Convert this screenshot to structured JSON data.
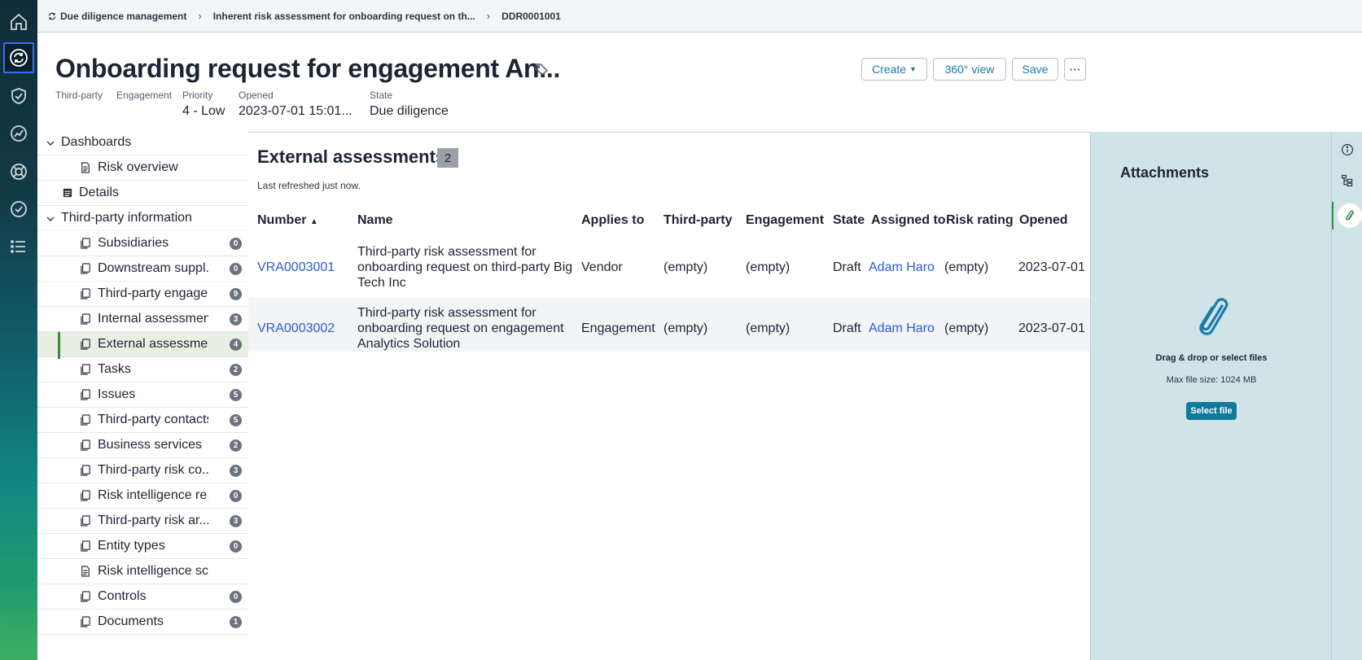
{
  "breadcrumb": {
    "items": [
      "Due diligence management",
      "Inherent risk assessment for onboarding request on th...",
      "DDR0001001"
    ]
  },
  "rail": {
    "icons": [
      "home-icon",
      "sync-icon",
      "shield-check-icon",
      "analytics-icon",
      "support-icon",
      "check-circle-icon",
      "list-icon"
    ]
  },
  "header": {
    "title": "Onboarding request for engagement An...",
    "meta": [
      {
        "label": "Third-party",
        "value": ""
      },
      {
        "label": "Engagement",
        "value": ""
      },
      {
        "label": "Priority",
        "value": "4 - Low"
      },
      {
        "label": "Opened",
        "value": "2023-07-01 15:01..."
      },
      {
        "label": "State",
        "value": "Due diligence"
      }
    ],
    "buttons": {
      "create": "Create",
      "view360": "360° view",
      "save": "Save",
      "more": "···"
    }
  },
  "nav": {
    "items": [
      {
        "label": "Dashboards",
        "count": null
      },
      {
        "label": "Risk overview",
        "count": null
      },
      {
        "label": "Details",
        "count": null
      },
      {
        "label": "Third-party information",
        "count": null
      },
      {
        "label": "Subsidiaries",
        "count": "0"
      },
      {
        "label": "Downstream suppl...",
        "count": "0"
      },
      {
        "label": "Third-party engage...",
        "count": "9"
      },
      {
        "label": "Internal assessments",
        "count": "3"
      },
      {
        "label": "External assessme...",
        "count": "4"
      },
      {
        "label": "Tasks",
        "count": "2"
      },
      {
        "label": "Issues",
        "count": "5"
      },
      {
        "label": "Third-party contacts",
        "count": "5"
      },
      {
        "label": "Business services",
        "count": "2"
      },
      {
        "label": "Third-party risk co...",
        "count": "3"
      },
      {
        "label": "Risk intelligence re...",
        "count": "0"
      },
      {
        "label": "Third-party risk ar...",
        "count": "3"
      },
      {
        "label": "Entity types",
        "count": "0"
      },
      {
        "label": "Risk intelligence scores",
        "count": null
      },
      {
        "label": "Controls",
        "count": "0"
      },
      {
        "label": "Documents",
        "count": "1"
      }
    ]
  },
  "main": {
    "title": "External assessments",
    "count": "2",
    "refreshed": "Last refreshed just now.",
    "sort_indicator": "▲",
    "columns": [
      "Number",
      "Name",
      "Applies to",
      "Third-party",
      "Engagement",
      "State",
      "Assigned to",
      "Risk rating",
      "Opened"
    ],
    "rows": [
      {
        "number": "VRA0003001",
        "name": "Third-party risk assessment for onboarding request on third-party Big Tech Inc",
        "applies_to": "Vendor",
        "third_party": "(empty)",
        "engagement": "(empty)",
        "state": "Draft",
        "assigned_to": "Adam Haro",
        "risk_rating": "(empty)",
        "opened": "2023-07-01"
      },
      {
        "number": "VRA0003002",
        "name": "Third-party risk assessment for onboarding request on engagement Analytics Solution",
        "applies_to": "Engagement",
        "third_party": "(empty)",
        "engagement": "(empty)",
        "state": "Draft",
        "assigned_to": "Adam Haro",
        "risk_rating": "(empty)",
        "opened": "2023-07-01"
      }
    ]
  },
  "attachments": {
    "title": "Attachments",
    "drag_text": "Drag & drop or select files",
    "max_size": "Max file size: 1024 MB",
    "select_button": "Select file"
  },
  "right_rail": {
    "icons": [
      "info-icon",
      "hierarchy-icon",
      "paperclip-icon"
    ]
  },
  "colors": {
    "link": "#2a5bd7",
    "accent": "#1a7ca9",
    "selected_nav": "#e7f0e2",
    "attach_panel": "#cfe3e8"
  }
}
